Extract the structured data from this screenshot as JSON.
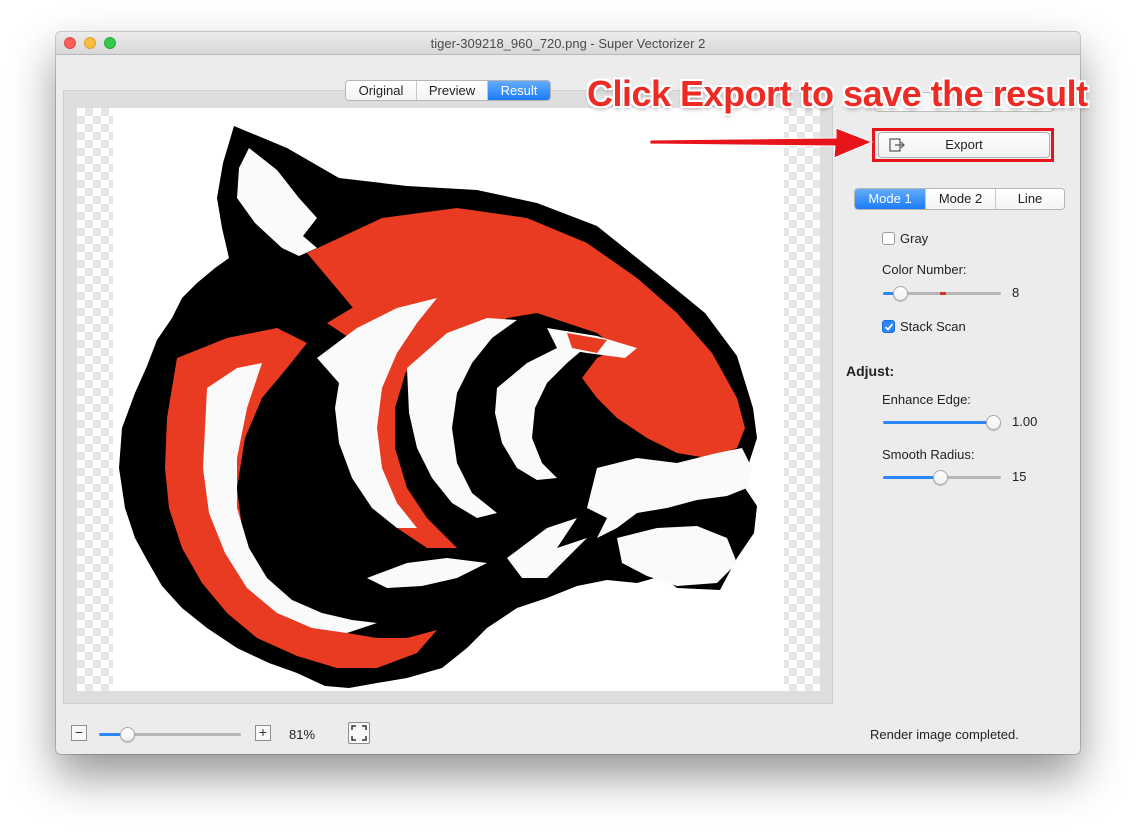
{
  "window": {
    "title": "tiger-309218_960_720.png - Super Vectorizer 2"
  },
  "view_tabs": [
    {
      "label": "Original",
      "selected": false
    },
    {
      "label": "Preview",
      "selected": false
    },
    {
      "label": "Result",
      "selected": true
    }
  ],
  "sidebar": {
    "export_label": "Export",
    "modes": [
      {
        "label": "Mode 1",
        "selected": true
      },
      {
        "label": "Mode 2",
        "selected": false
      },
      {
        "label": "Line",
        "selected": false
      }
    ],
    "gray": {
      "label": "Gray",
      "checked": false
    },
    "color_number": {
      "label": "Color Number:",
      "value": "8"
    },
    "stack_scan": {
      "label": "Stack Scan",
      "checked": true
    },
    "adjust_heading": "Adjust:",
    "enhance_edge": {
      "label": "Enhance Edge:",
      "value": "1.00"
    },
    "smooth_radius": {
      "label": "Smooth Radius:",
      "value": "15"
    }
  },
  "bottom_bar": {
    "zoom_value": "81%",
    "status": "Render image completed."
  },
  "annotation": {
    "text": "Click Export to save the result"
  },
  "colors": {
    "accent": "#2b86f7",
    "annotation": "#ee2a24",
    "tiger_orange": "#e93a22",
    "tiger_black": "#000000",
    "tiger_white": "#fafafa"
  },
  "icons": {
    "export": "export-icon",
    "zoom_out": "minus-icon",
    "zoom_in": "plus-icon",
    "fit": "fit-screen-icon"
  }
}
